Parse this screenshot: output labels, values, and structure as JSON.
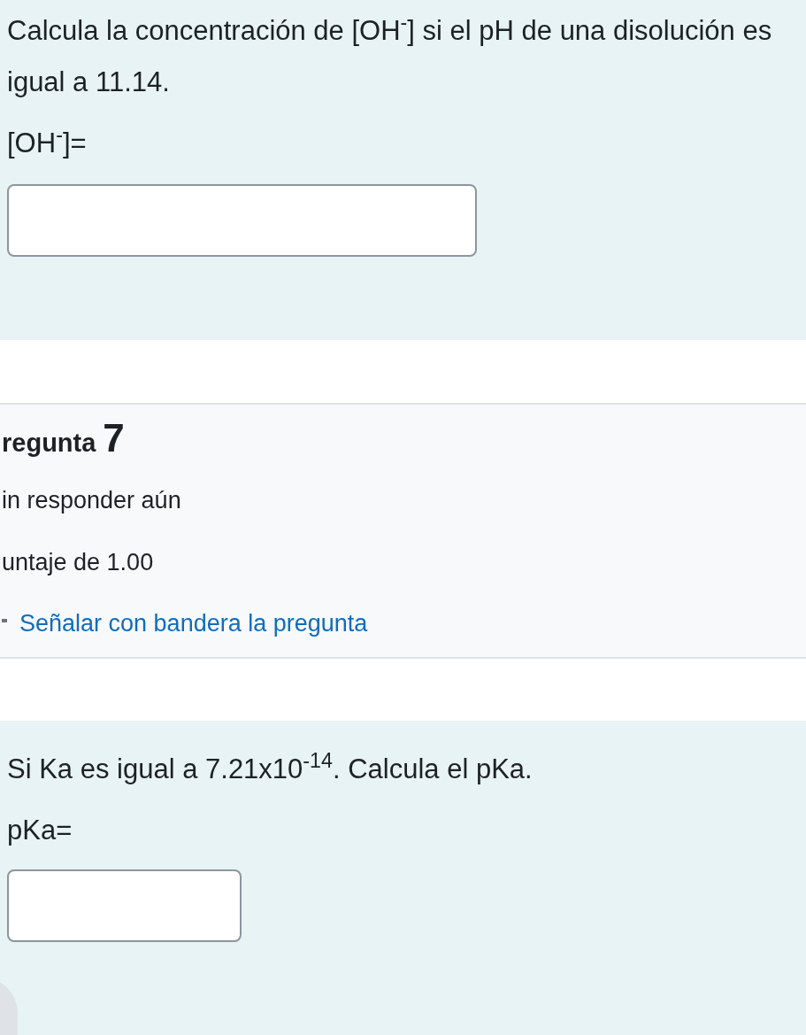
{
  "question_6": {
    "text": "Calcula la concentración de [OH$^{-}$] si el pH de una disolución es igual a 11.14.",
    "answer_label": "[OH$^{-}$]="
  },
  "question_7_info": {
    "title": "regunta",
    "number": "7",
    "status": "in responder aún",
    "grade": "untaje de 1.00",
    "flag": {
      "label": "Señalar con bandera la pregunta",
      "flagged": false
    }
  },
  "question_7": {
    "text": "Si Ka es igual a 7.21x10$^{-14}$. Calcula el pKa.",
    "answer_label": "pKa="
  }
}
